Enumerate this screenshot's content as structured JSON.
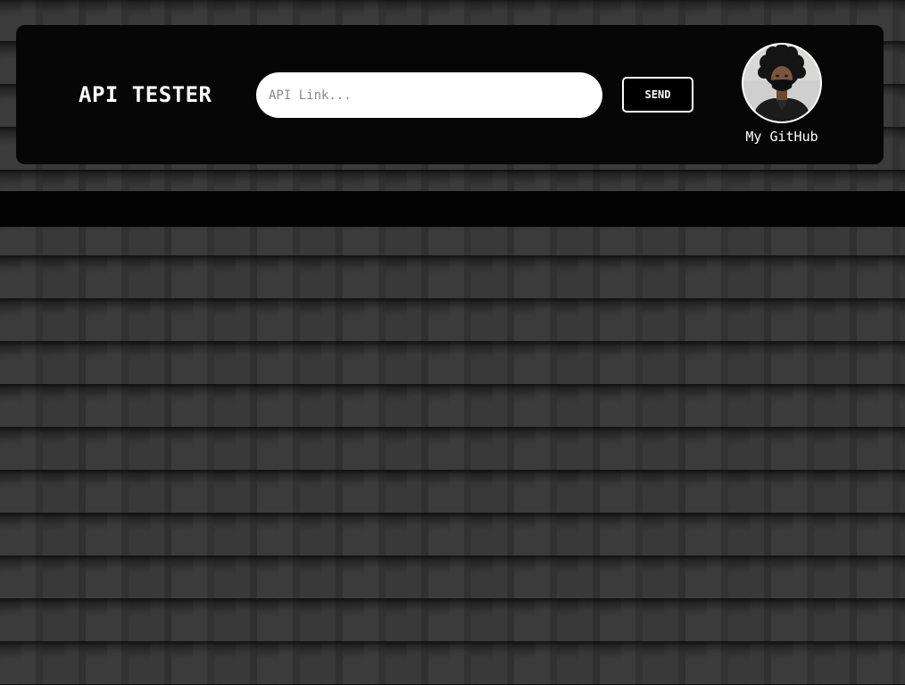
{
  "header": {
    "title": "API TESTER",
    "input": {
      "placeholder": "API Link...",
      "value": ""
    },
    "send_label": "SEND",
    "github": {
      "label": "My GitHub",
      "avatar_icon": "user-avatar-photo"
    }
  },
  "response": {
    "text": ""
  },
  "colors": {
    "panel_bg": "#060606",
    "text": "#ffffff",
    "page_bg": "#353535"
  }
}
